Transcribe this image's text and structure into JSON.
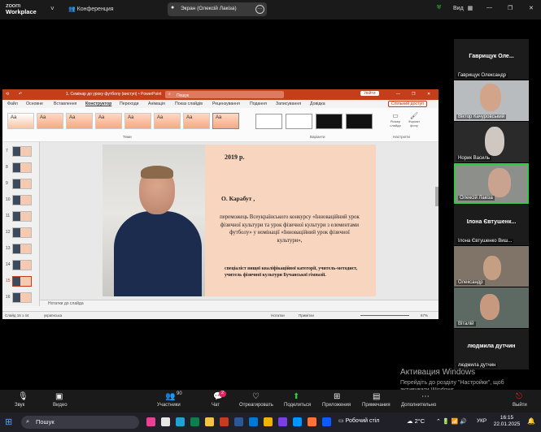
{
  "zoom": {
    "logo_line1": "zoom",
    "logo_line2": "Workplace",
    "chevron": "˅",
    "conference_label": "Конференция",
    "screen_share_label": "Экран (Олексій Лакіза)",
    "more_dots": "···",
    "view_label": "Вид",
    "view_grid_icon": "grid-icon",
    "shield_color": "#2ecc40"
  },
  "ppt": {
    "title": "1. Семінар до уроку футболу (виступ) • PowerPoint",
    "search_placeholder": "Пошук",
    "signin": "Увійти",
    "menu": [
      "Файл",
      "Основне",
      "Вставлення",
      "Конструктор",
      "Переходи",
      "Анімація",
      "Показ слайдів",
      "Рецензування",
      "Подання",
      "Записування",
      "Довідка"
    ],
    "share_label": "Спільний доступ",
    "theme_label": "Aa",
    "themes_group": "Теми",
    "variants_group": "Варіанти",
    "customize_group": "Настроїти",
    "slide_size": "Розмір слайда",
    "format_bg": "Формат фону",
    "thumb_numbers": [
      "7",
      "8",
      "9",
      "10",
      "11",
      "12",
      "13",
      "14",
      "15",
      "16"
    ],
    "slide": {
      "year": "2019 р.",
      "name": "О. Карабут ,",
      "winner_text": "переможець Всеукраїнського конкурсу «Інноваційний урок фізичної культури та урок фізичної культури з елементами футболу» у номінації «Інноваційний урок фізичної культури»,",
      "specialist_text": "спеціаліст вищої кваліфікаційної категорії, учитель-методист, учитель фізичної культури Бучанської гімназії."
    },
    "notes_placeholder": "Нотатки до слайда",
    "status_slide": "Слайд 15 з 44",
    "status_lang": "українська",
    "status_notes": "Нотатки",
    "status_comments": "Примітки",
    "zoom_level": "67%"
  },
  "gallery": [
    {
      "big": "Гаврищук Оле...",
      "name": "Гаврищук Олександр"
    },
    {
      "name": "Віктор Качуровський"
    },
    {
      "name": "Норик Василь"
    },
    {
      "name": "Олексій Лакіза"
    },
    {
      "big": "Ілона Євтушенк...",
      "name": "Ілона Євтушенко Виш..."
    },
    {
      "name": "Олександр"
    },
    {
      "name": "Віталій"
    },
    {
      "big": "людмила дутчин",
      "name": "людмила дутчин"
    }
  ],
  "toolbar": {
    "audio": "Звук",
    "video": "Видео",
    "participants": "Участники",
    "participants_count": "90",
    "chat": "Чат",
    "chat_badge": "2",
    "react": "Отреагировать",
    "share": "Поделиться",
    "apps": "Приложения",
    "notes": "Примечания",
    "more": "Дополнительно",
    "leave": "Выйти"
  },
  "activation": {
    "title": "Активация Windows",
    "line1": "Перейдіть до розділу \"Настройки\", щоб",
    "line2": "активувати Windows."
  },
  "taskbar": {
    "search": "Пошук",
    "desktop": "Робочий стіл",
    "weather": "2°C",
    "lang": "УКР",
    "time": "16:15",
    "date": "22.01.2025"
  }
}
